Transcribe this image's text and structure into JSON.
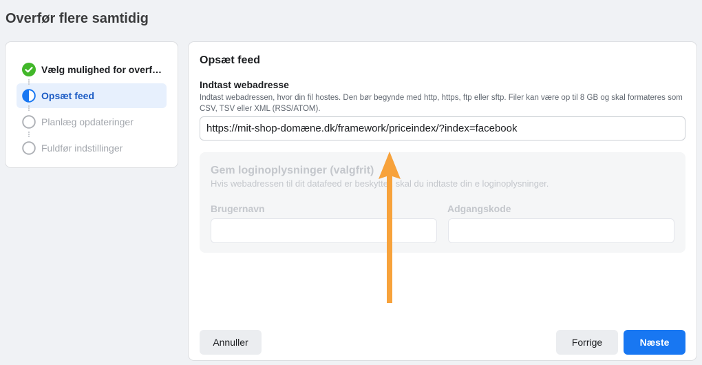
{
  "page": {
    "title": "Overfør flere samtidig"
  },
  "stepper": {
    "steps": [
      {
        "label": "Vælg mulighed for overførsel",
        "state": "done"
      },
      {
        "label": "Opsæt feed",
        "state": "active"
      },
      {
        "label": "Planlæg opdateringer",
        "state": "pending"
      },
      {
        "label": "Fuldfør indstillinger",
        "state": "pending"
      }
    ]
  },
  "main": {
    "title": "Opsæt feed",
    "url_field": {
      "label": "Indtast webadresse",
      "help": "Indtast webadressen, hvor din fil hostes. Den bør begynde med http, https, ftp eller sftp. Filer kan være op til 8 GB og skal formateres som CSV, TSV eller XML (RSS/ATOM).",
      "value": "https://mit-shop-domæne.dk/framework/priceindex/?index=facebook"
    },
    "login": {
      "title": "Gem loginoplysninger (valgfrit)",
      "help": "Hvis webadressen til dit datafeed er beskyttet, skal du indtaste din e loginoplysninger.",
      "username_label": "Brugernavn",
      "password_label": "Adgangskode"
    }
  },
  "footer": {
    "cancel_label": "Annuller",
    "back_label": "Forrige",
    "next_label": "Næste"
  },
  "colors": {
    "accent": "#1877f2",
    "done": "#42b72a",
    "annotation_arrow": "#f7a23b"
  }
}
